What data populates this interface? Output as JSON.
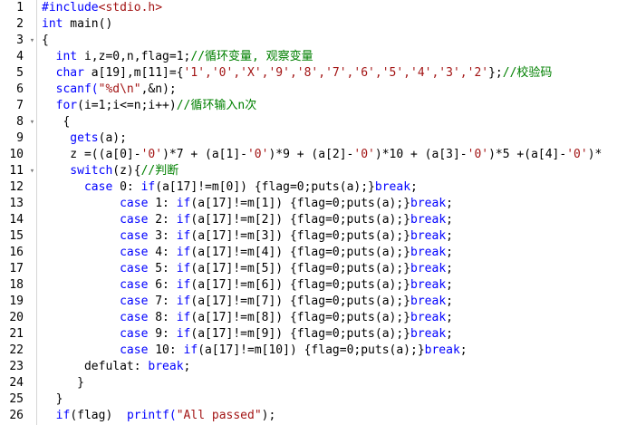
{
  "editor": {
    "lines": [
      {
        "n": "1",
        "fold": "",
        "segs": [
          {
            "t": "#include",
            "c": "pp"
          },
          {
            "t": "<stdio.h>",
            "c": "st"
          }
        ]
      },
      {
        "n": "2",
        "fold": "",
        "segs": [
          {
            "t": "int",
            "c": "kw"
          },
          {
            "t": " main()",
            "c": "op"
          }
        ]
      },
      {
        "n": "3",
        "fold": "▾",
        "segs": [
          {
            "t": "{",
            "c": "op"
          }
        ]
      },
      {
        "n": "4",
        "fold": "",
        "segs": [
          {
            "t": "  int",
            "c": "kw"
          },
          {
            "t": " i,z=0,n,flag=1;",
            "c": "op"
          },
          {
            "t": "//循环变量, 观察变量",
            "c": "cm"
          }
        ]
      },
      {
        "n": "5",
        "fold": "",
        "segs": [
          {
            "t": "  char",
            "c": "kw"
          },
          {
            "t": " a[19],m[11]={",
            "c": "op"
          },
          {
            "t": "'1','0','X','9','8','7','6','5','4','3','2'",
            "c": "st"
          },
          {
            "t": "};",
            "c": "op"
          },
          {
            "t": "//校验码",
            "c": "cm"
          }
        ]
      },
      {
        "n": "6",
        "fold": "",
        "segs": [
          {
            "t": "  scanf(",
            "c": "kw"
          },
          {
            "t": "\"%d\\n\"",
            "c": "st"
          },
          {
            "t": ",&n);",
            "c": "op"
          }
        ]
      },
      {
        "n": "7",
        "fold": "",
        "segs": [
          {
            "t": "  for",
            "c": "kw"
          },
          {
            "t": "(i=1;i<=n;i++)",
            "c": "op"
          },
          {
            "t": "//循环输入n次",
            "c": "cm"
          }
        ]
      },
      {
        "n": "8",
        "fold": "▾",
        "segs": [
          {
            "t": "   {",
            "c": "op"
          }
        ]
      },
      {
        "n": "9",
        "fold": "",
        "segs": [
          {
            "t": "    gets",
            "c": "kw"
          },
          {
            "t": "(a);",
            "c": "op"
          }
        ]
      },
      {
        "n": "10",
        "fold": "",
        "segs": [
          {
            "t": "    z =((a[0]-",
            "c": "op"
          },
          {
            "t": "'0'",
            "c": "st"
          },
          {
            "t": ")*7 + (a[1]-",
            "c": "op"
          },
          {
            "t": "'0'",
            "c": "st"
          },
          {
            "t": ")*9 + (a[2]-",
            "c": "op"
          },
          {
            "t": "'0'",
            "c": "st"
          },
          {
            "t": ")*10 + (a[3]-",
            "c": "op"
          },
          {
            "t": "'0'",
            "c": "st"
          },
          {
            "t": ")*5 +(a[4]-",
            "c": "op"
          },
          {
            "t": "'0'",
            "c": "st"
          },
          {
            "t": ")*",
            "c": "op"
          }
        ]
      },
      {
        "n": "11",
        "fold": "▾",
        "segs": [
          {
            "t": "    switch",
            "c": "kw"
          },
          {
            "t": "(z){",
            "c": "op"
          },
          {
            "t": "//判断",
            "c": "cm"
          }
        ]
      },
      {
        "n": "12",
        "fold": "",
        "segs": [
          {
            "t": "      case",
            "c": "kw"
          },
          {
            "t": " 0: ",
            "c": "op"
          },
          {
            "t": "if",
            "c": "kw"
          },
          {
            "t": "(a[17]!=m[0]) {flag=0;puts(a);}",
            "c": "op"
          },
          {
            "t": "break",
            "c": "kw"
          },
          {
            "t": ";",
            "c": "op"
          }
        ]
      },
      {
        "n": "13",
        "fold": "",
        "segs": [
          {
            "t": "           case",
            "c": "kw"
          },
          {
            "t": " 1: ",
            "c": "op"
          },
          {
            "t": "if",
            "c": "kw"
          },
          {
            "t": "(a[17]!=m[1]) {flag=0;puts(a);}",
            "c": "op"
          },
          {
            "t": "break",
            "c": "kw"
          },
          {
            "t": ";",
            "c": "op"
          }
        ]
      },
      {
        "n": "14",
        "fold": "",
        "segs": [
          {
            "t": "           case",
            "c": "kw"
          },
          {
            "t": " 2: ",
            "c": "op"
          },
          {
            "t": "if",
            "c": "kw"
          },
          {
            "t": "(a[17]!=m[2]) {flag=0;puts(a);}",
            "c": "op"
          },
          {
            "t": "break",
            "c": "kw"
          },
          {
            "t": ";",
            "c": "op"
          }
        ]
      },
      {
        "n": "15",
        "fold": "",
        "segs": [
          {
            "t": "           case",
            "c": "kw"
          },
          {
            "t": " 3: ",
            "c": "op"
          },
          {
            "t": "if",
            "c": "kw"
          },
          {
            "t": "(a[17]!=m[3]) {flag=0;puts(a);}",
            "c": "op"
          },
          {
            "t": "break",
            "c": "kw"
          },
          {
            "t": ";",
            "c": "op"
          }
        ]
      },
      {
        "n": "16",
        "fold": "",
        "segs": [
          {
            "t": "           case",
            "c": "kw"
          },
          {
            "t": " 4: ",
            "c": "op"
          },
          {
            "t": "if",
            "c": "kw"
          },
          {
            "t": "(a[17]!=m[4]) {flag=0;puts(a);}",
            "c": "op"
          },
          {
            "t": "break",
            "c": "kw"
          },
          {
            "t": ";",
            "c": "op"
          }
        ]
      },
      {
        "n": "17",
        "fold": "",
        "segs": [
          {
            "t": "           case",
            "c": "kw"
          },
          {
            "t": " 5: ",
            "c": "op"
          },
          {
            "t": "if",
            "c": "kw"
          },
          {
            "t": "(a[17]!=m[5]) {flag=0;puts(a);}",
            "c": "op"
          },
          {
            "t": "break",
            "c": "kw"
          },
          {
            "t": ";",
            "c": "op"
          }
        ]
      },
      {
        "n": "18",
        "fold": "",
        "segs": [
          {
            "t": "           case",
            "c": "kw"
          },
          {
            "t": " 6: ",
            "c": "op"
          },
          {
            "t": "if",
            "c": "kw"
          },
          {
            "t": "(a[17]!=m[6]) {flag=0;puts(a);}",
            "c": "op"
          },
          {
            "t": "break",
            "c": "kw"
          },
          {
            "t": ";",
            "c": "op"
          }
        ]
      },
      {
        "n": "19",
        "fold": "",
        "segs": [
          {
            "t": "           case",
            "c": "kw"
          },
          {
            "t": " 7: ",
            "c": "op"
          },
          {
            "t": "if",
            "c": "kw"
          },
          {
            "t": "(a[17]!=m[7]) {flag=0;puts(a);}",
            "c": "op"
          },
          {
            "t": "break",
            "c": "kw"
          },
          {
            "t": ";",
            "c": "op"
          }
        ]
      },
      {
        "n": "20",
        "fold": "",
        "segs": [
          {
            "t": "           case",
            "c": "kw"
          },
          {
            "t": " 8: ",
            "c": "op"
          },
          {
            "t": "if",
            "c": "kw"
          },
          {
            "t": "(a[17]!=m[8]) {flag=0;puts(a);}",
            "c": "op"
          },
          {
            "t": "break",
            "c": "kw"
          },
          {
            "t": ";",
            "c": "op"
          }
        ]
      },
      {
        "n": "21",
        "fold": "",
        "segs": [
          {
            "t": "           case",
            "c": "kw"
          },
          {
            "t": " 9: ",
            "c": "op"
          },
          {
            "t": "if",
            "c": "kw"
          },
          {
            "t": "(a[17]!=m[9]) {flag=0;puts(a);}",
            "c": "op"
          },
          {
            "t": "break",
            "c": "kw"
          },
          {
            "t": ";",
            "c": "op"
          }
        ]
      },
      {
        "n": "22",
        "fold": "",
        "segs": [
          {
            "t": "           case",
            "c": "kw"
          },
          {
            "t": " 10: ",
            "c": "op"
          },
          {
            "t": "if",
            "c": "kw"
          },
          {
            "t": "(a[17]!=m[10]) {flag=0;puts(a);}",
            "c": "op"
          },
          {
            "t": "break",
            "c": "kw"
          },
          {
            "t": ";",
            "c": "op"
          }
        ]
      },
      {
        "n": "23",
        "fold": "",
        "segs": [
          {
            "t": "      defulat: ",
            "c": "op"
          },
          {
            "t": "break",
            "c": "kw"
          },
          {
            "t": ";",
            "c": "op"
          }
        ]
      },
      {
        "n": "24",
        "fold": "",
        "segs": [
          {
            "t": "     }",
            "c": "op"
          }
        ]
      },
      {
        "n": "25",
        "fold": "",
        "segs": [
          {
            "t": "  }",
            "c": "op"
          }
        ]
      },
      {
        "n": "26",
        "fold": "",
        "segs": [
          {
            "t": "  if",
            "c": "kw"
          },
          {
            "t": "(flag)  ",
            "c": "op"
          },
          {
            "t": "printf(",
            "c": "kw"
          },
          {
            "t": "\"All passed\"",
            "c": "st"
          },
          {
            "t": ");",
            "c": "op"
          }
        ]
      }
    ]
  }
}
